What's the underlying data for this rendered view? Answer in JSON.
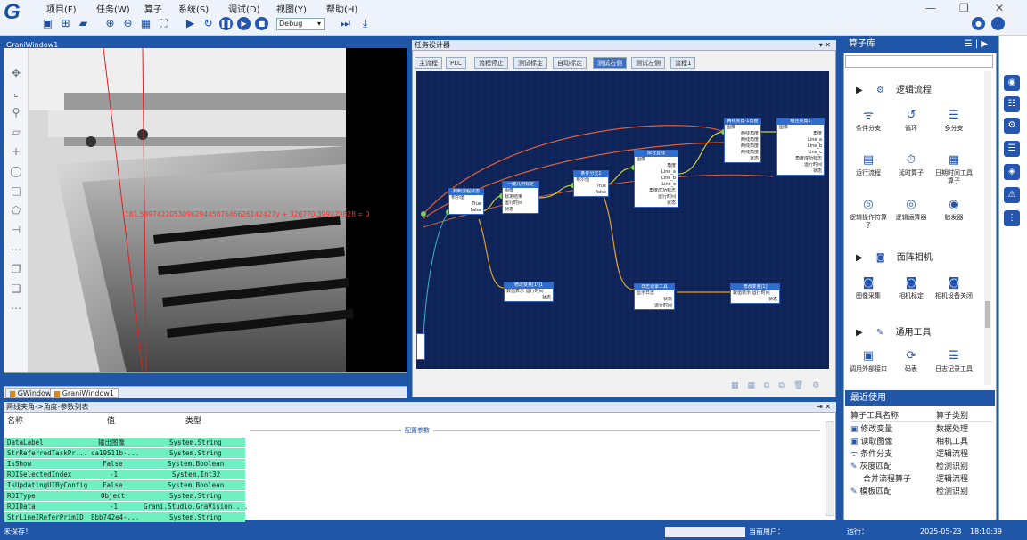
{
  "app": {
    "menus": [
      "项目(F)",
      "任务(W)",
      "算子",
      "系统(S)",
      "调试(D)",
      "视图(Y)",
      "帮助(H)"
    ],
    "debug_mode": "Debug"
  },
  "image_window": {
    "title": "GraniWindow1",
    "overlay_text": "181.58974220530962944587646626142427y + 320770.399279828 = 0",
    "tabs": [
      "GWindow",
      "GraniWindow1"
    ]
  },
  "task_panel": {
    "title": "任务设计器",
    "flow_tabs": [
      "主流程",
      "PLC",
      "流程停止",
      "测试标定",
      "自动标定",
      "测试右侧",
      "测试左侧",
      "流程1"
    ],
    "active_flow_tab": "测试右侧",
    "nodes": [
      {
        "title": "两线夹角-1角度",
        "rows": [
          "图像",
          "两线夹角",
          "两线角度",
          "两线角度",
          "两线角度",
          "两线角度",
          "状态"
        ]
      },
      {
        "title": "组合夹角1",
        "rows": [
          "图像",
          "直线",
          "角度",
          "Line_a",
          "Line_b",
          "Line_c",
          "角度成功标志",
          "运行时间",
          "状态"
        ]
      },
      {
        "title": "拟合直线",
        "rows": [
          "图像",
          "直线",
          "角度",
          "Line_a",
          "Line_b",
          "Line_c",
          "角度成功标志",
          "运行时间",
          "状态"
        ]
      },
      {
        "title": "条件分支1",
        "rows": [
          "布尔值",
          "True",
          "False"
        ]
      },
      {
        "title": "一键几何标定",
        "rows": [
          "图像",
          "图像",
          "标定结果",
          "运行时间",
          "状态"
        ]
      },
      {
        "title": "判断流程状态",
        "rows": [
          "布尔值",
          "True",
          "False"
        ]
      },
      {
        "title": "修改变量[1\\]1",
        "rows": [
          "数值表示 运行时间",
          "状态"
        ]
      },
      {
        "title": "日志记录工具",
        "rows": [
          "显示日志",
          "状态",
          "运行时间"
        ]
      },
      {
        "title": "修改变量[1]",
        "rows": [
          "数值表示 运行时间",
          "状态"
        ]
      }
    ]
  },
  "params": {
    "title": "两线夹角->角度-参数列表",
    "columns": [
      "名称",
      "值",
      "类型"
    ],
    "section": "配置参数",
    "rows": [
      [
        "DataLabel",
        "输出图像",
        "System.String"
      ],
      [
        "StrReferredTaskPr...",
        "ca19511b-...",
        "System.String"
      ],
      [
        "IsShow",
        "False",
        "System.Boolean"
      ],
      [
        "ROISelectedIndex",
        "-1",
        "System.Int32"
      ],
      [
        "IsUpdatingUIByConfig",
        "False",
        "System.Boolean"
      ],
      [
        "ROIType",
        "Object",
        "System.String"
      ],
      [
        "ROIData",
        "-1",
        "Grani.Studio.GraVision...."
      ],
      [
        "StrLineIReferPrimID",
        "8bb742e4-...",
        "System.String"
      ]
    ]
  },
  "library": {
    "title": "算子库",
    "sections": [
      {
        "name": "逻辑流程",
        "items": [
          "条件分支",
          "循环",
          "多分支",
          "运行流程",
          "延时算子",
          "日期时间工具算子",
          "逻辑操作符算子",
          "逻辑运算器",
          "触发器"
        ]
      },
      {
        "name": "面阵相机",
        "items": [
          "图像采集",
          "相机标定",
          "相机设备关闭"
        ]
      },
      {
        "name": "通用工具",
        "items": [
          "调用外部接口",
          "码表",
          "日志记录工具"
        ]
      }
    ]
  },
  "recent": {
    "title": "最近使用",
    "columns": [
      "算子工具名称",
      "算子类别"
    ],
    "rows": [
      [
        "修改变量",
        "数据处理"
      ],
      [
        "读取图像",
        "相机工具"
      ],
      [
        "条件分支",
        "逻辑流程"
      ],
      [
        "灰度匹配",
        "检测识别"
      ],
      [
        "合并流程算子",
        "逻辑流程"
      ],
      [
        "模板匹配",
        "检测识别"
      ]
    ]
  },
  "status": {
    "left": "未保存！",
    "user_label": "当前用户：",
    "run_label": "运行：",
    "date": "2025-05-23",
    "time": "18:10:39"
  }
}
